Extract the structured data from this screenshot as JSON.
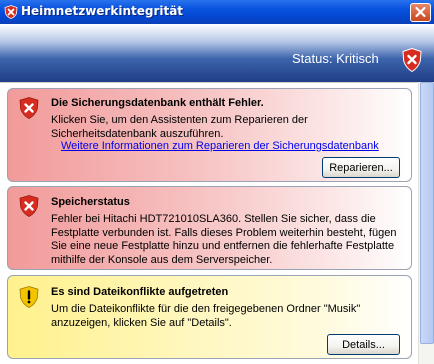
{
  "window": {
    "title": "Heimnetzwerkintegrität",
    "status_text": "Status: Kritisch"
  },
  "alerts": [
    {
      "severity": "critical",
      "icon": "error-shield-icon",
      "title": "Die Sicherungsdatenbank enthält Fehler.",
      "text_lines": [
        "Klicken Sie, um den Assistenten zum Reparieren der",
        "Sicherheitsdatenbank auszuführen."
      ],
      "link": "Weitere Informationen zum Reparieren der Sicherungsdatenbank",
      "button": "Reparieren..."
    },
    {
      "severity": "critical",
      "icon": "error-shield-icon",
      "title": "Speicherstatus",
      "text_lines": [
        "Fehler bei Hitachi HDT721010SLA360. Stellen Sie sicher, dass die",
        "Festplatte verbunden ist. Falls dieses Problem weiterhin besteht, fügen",
        "Sie eine neue Festplatte hinzu und entfernen die fehlerhafte Festplatte",
        "mithilfe der Konsole aus dem Serverspeicher."
      ]
    },
    {
      "severity": "warning",
      "icon": "warning-shield-icon",
      "title": "Es sind Dateikonflikte aufgetreten",
      "text_lines": [
        "Um die Dateikonflikte für die den freigegebenen Ordner \"Musik\"",
        "anzuzeigen, klicken Sie auf \"Details\"."
      ],
      "button": "Details..."
    }
  ],
  "colors": {
    "critical": "#d62d20",
    "warning": "#f5c400",
    "link": "#0000ee"
  }
}
